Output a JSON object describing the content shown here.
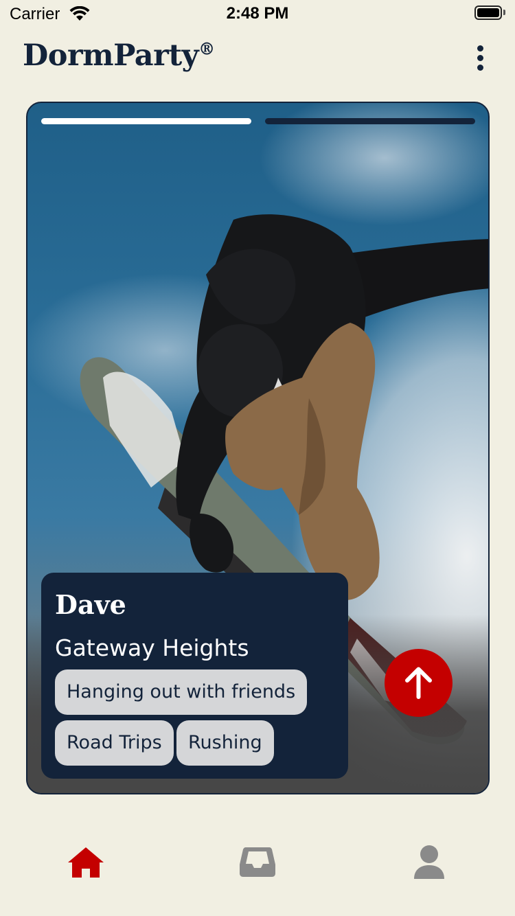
{
  "status_bar": {
    "carrier": "Carrier",
    "time": "2:48 PM"
  },
  "header": {
    "title": "DormParty",
    "title_mark": "®",
    "more_icon": "more-vertical-icon"
  },
  "card": {
    "photo_description_icon": "snowboarder-photo",
    "story_progress": [
      1,
      0
    ],
    "name": "Dave",
    "location": "Gateway Heights",
    "tags": [
      "Hanging out with friends",
      "Road Trips",
      "Rushing"
    ],
    "action_icon": "arrow-up-icon"
  },
  "tab_bar": {
    "items": [
      {
        "icon": "home-icon",
        "active": true
      },
      {
        "icon": "inbox-icon",
        "active": false
      },
      {
        "icon": "profile-icon",
        "active": false
      }
    ]
  },
  "colors": {
    "background": "#f1efe2",
    "navy": "#13233a",
    "accent_red": "#c40000",
    "tag_bg": "#d5d6d8",
    "inactive_icon": "#8a8a8a"
  }
}
